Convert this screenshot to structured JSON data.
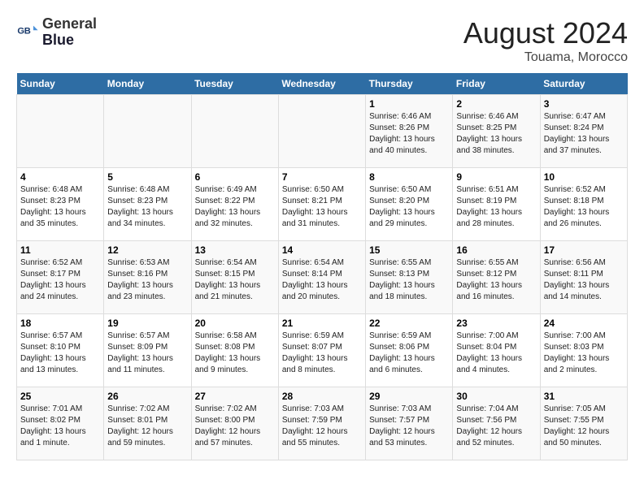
{
  "logo": {
    "line1": "General",
    "line2": "Blue"
  },
  "title": "August 2024",
  "subtitle": "Touama, Morocco",
  "weekdays": [
    "Sunday",
    "Monday",
    "Tuesday",
    "Wednesday",
    "Thursday",
    "Friday",
    "Saturday"
  ],
  "weeks": [
    [
      {
        "num": "",
        "info": ""
      },
      {
        "num": "",
        "info": ""
      },
      {
        "num": "",
        "info": ""
      },
      {
        "num": "",
        "info": ""
      },
      {
        "num": "1",
        "info": "Sunrise: 6:46 AM\nSunset: 8:26 PM\nDaylight: 13 hours\nand 40 minutes."
      },
      {
        "num": "2",
        "info": "Sunrise: 6:46 AM\nSunset: 8:25 PM\nDaylight: 13 hours\nand 38 minutes."
      },
      {
        "num": "3",
        "info": "Sunrise: 6:47 AM\nSunset: 8:24 PM\nDaylight: 13 hours\nand 37 minutes."
      }
    ],
    [
      {
        "num": "4",
        "info": "Sunrise: 6:48 AM\nSunset: 8:23 PM\nDaylight: 13 hours\nand 35 minutes."
      },
      {
        "num": "5",
        "info": "Sunrise: 6:48 AM\nSunset: 8:23 PM\nDaylight: 13 hours\nand 34 minutes."
      },
      {
        "num": "6",
        "info": "Sunrise: 6:49 AM\nSunset: 8:22 PM\nDaylight: 13 hours\nand 32 minutes."
      },
      {
        "num": "7",
        "info": "Sunrise: 6:50 AM\nSunset: 8:21 PM\nDaylight: 13 hours\nand 31 minutes."
      },
      {
        "num": "8",
        "info": "Sunrise: 6:50 AM\nSunset: 8:20 PM\nDaylight: 13 hours\nand 29 minutes."
      },
      {
        "num": "9",
        "info": "Sunrise: 6:51 AM\nSunset: 8:19 PM\nDaylight: 13 hours\nand 28 minutes."
      },
      {
        "num": "10",
        "info": "Sunrise: 6:52 AM\nSunset: 8:18 PM\nDaylight: 13 hours\nand 26 minutes."
      }
    ],
    [
      {
        "num": "11",
        "info": "Sunrise: 6:52 AM\nSunset: 8:17 PM\nDaylight: 13 hours\nand 24 minutes."
      },
      {
        "num": "12",
        "info": "Sunrise: 6:53 AM\nSunset: 8:16 PM\nDaylight: 13 hours\nand 23 minutes."
      },
      {
        "num": "13",
        "info": "Sunrise: 6:54 AM\nSunset: 8:15 PM\nDaylight: 13 hours\nand 21 minutes."
      },
      {
        "num": "14",
        "info": "Sunrise: 6:54 AM\nSunset: 8:14 PM\nDaylight: 13 hours\nand 20 minutes."
      },
      {
        "num": "15",
        "info": "Sunrise: 6:55 AM\nSunset: 8:13 PM\nDaylight: 13 hours\nand 18 minutes."
      },
      {
        "num": "16",
        "info": "Sunrise: 6:55 AM\nSunset: 8:12 PM\nDaylight: 13 hours\nand 16 minutes."
      },
      {
        "num": "17",
        "info": "Sunrise: 6:56 AM\nSunset: 8:11 PM\nDaylight: 13 hours\nand 14 minutes."
      }
    ],
    [
      {
        "num": "18",
        "info": "Sunrise: 6:57 AM\nSunset: 8:10 PM\nDaylight: 13 hours\nand 13 minutes."
      },
      {
        "num": "19",
        "info": "Sunrise: 6:57 AM\nSunset: 8:09 PM\nDaylight: 13 hours\nand 11 minutes."
      },
      {
        "num": "20",
        "info": "Sunrise: 6:58 AM\nSunset: 8:08 PM\nDaylight: 13 hours\nand 9 minutes."
      },
      {
        "num": "21",
        "info": "Sunrise: 6:59 AM\nSunset: 8:07 PM\nDaylight: 13 hours\nand 8 minutes."
      },
      {
        "num": "22",
        "info": "Sunrise: 6:59 AM\nSunset: 8:06 PM\nDaylight: 13 hours\nand 6 minutes."
      },
      {
        "num": "23",
        "info": "Sunrise: 7:00 AM\nSunset: 8:04 PM\nDaylight: 13 hours\nand 4 minutes."
      },
      {
        "num": "24",
        "info": "Sunrise: 7:00 AM\nSunset: 8:03 PM\nDaylight: 13 hours\nand 2 minutes."
      }
    ],
    [
      {
        "num": "25",
        "info": "Sunrise: 7:01 AM\nSunset: 8:02 PM\nDaylight: 13 hours\nand 1 minute."
      },
      {
        "num": "26",
        "info": "Sunrise: 7:02 AM\nSunset: 8:01 PM\nDaylight: 12 hours\nand 59 minutes."
      },
      {
        "num": "27",
        "info": "Sunrise: 7:02 AM\nSunset: 8:00 PM\nDaylight: 12 hours\nand 57 minutes."
      },
      {
        "num": "28",
        "info": "Sunrise: 7:03 AM\nSunset: 7:59 PM\nDaylight: 12 hours\nand 55 minutes."
      },
      {
        "num": "29",
        "info": "Sunrise: 7:03 AM\nSunset: 7:57 PM\nDaylight: 12 hours\nand 53 minutes."
      },
      {
        "num": "30",
        "info": "Sunrise: 7:04 AM\nSunset: 7:56 PM\nDaylight: 12 hours\nand 52 minutes."
      },
      {
        "num": "31",
        "info": "Sunrise: 7:05 AM\nSunset: 7:55 PM\nDaylight: 12 hours\nand 50 minutes."
      }
    ]
  ]
}
